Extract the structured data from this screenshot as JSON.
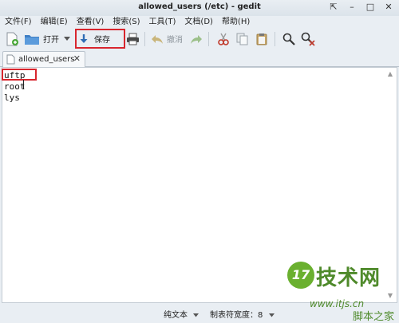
{
  "window": {
    "title": "allowed_users (/etc) - gedit",
    "controls": {
      "restore": "⇱",
      "minimize": "–",
      "maximize": "□",
      "close": "✕"
    }
  },
  "menubar": {
    "items": [
      {
        "label": "文件(F)"
      },
      {
        "label": "编辑(E)"
      },
      {
        "label": "查看(V)"
      },
      {
        "label": "搜索(S)"
      },
      {
        "label": "工具(T)"
      },
      {
        "label": "文档(D)"
      },
      {
        "label": "帮助(H)"
      }
    ]
  },
  "toolbar": {
    "open_label": "打开",
    "save_label": "保存",
    "undo_label": "撤消"
  },
  "tabs": [
    {
      "label": "allowed_users",
      "close": "✕"
    }
  ],
  "editor": {
    "lines": [
      "uftp",
      "root",
      "lys"
    ]
  },
  "statusbar": {
    "syntax": "纯文本",
    "tab_width": "制表符宽度：8"
  },
  "watermark": {
    "logo_text": "17",
    "brand": "技术网",
    "url": "www.itjs.cn",
    "site": "脚本之家"
  },
  "colors": {
    "highlight": "#d8262e",
    "accent_blue": "#2f6db5",
    "watermark_green": "#4f8a2b"
  }
}
